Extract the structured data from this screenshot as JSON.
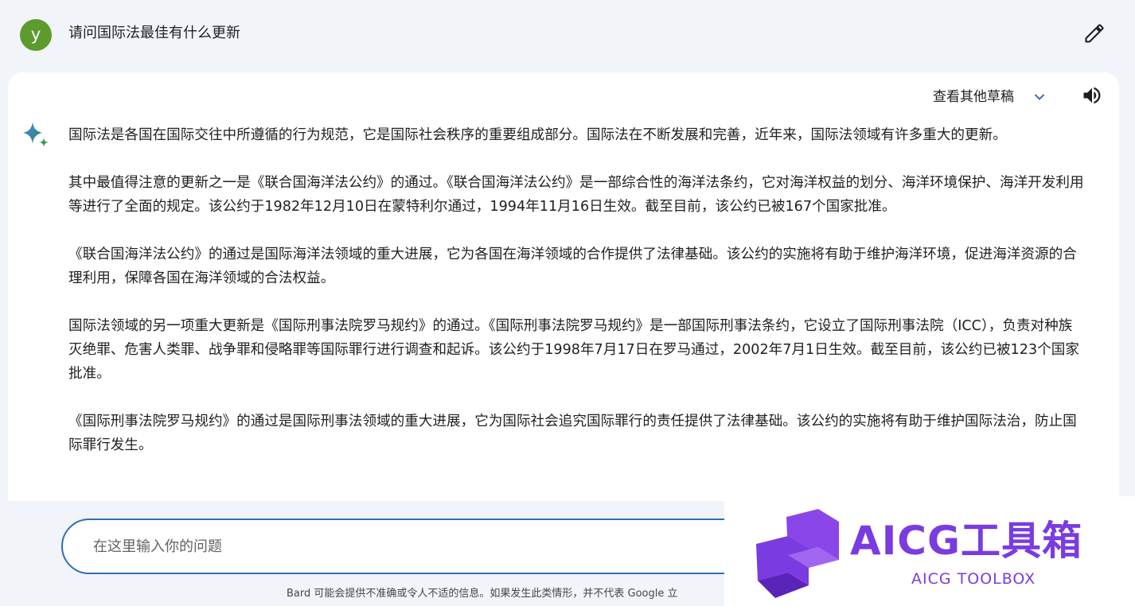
{
  "user": {
    "avatar_letter": "y",
    "query": "请问国际法最佳有什么更新"
  },
  "response": {
    "drafts_label": "查看其他草稿",
    "paragraphs": [
      "国际法是各国在国际交往中所遵循的行为规范，它是国际社会秩序的重要组成部分。国际法在不断发展和完善，近年来，国际法领域有许多重大的更新。",
      "其中最值得注意的更新之一是《联合国海洋法公约》的通过。《联合国海洋法公约》是一部综合性的海洋法条约，它对海洋权益的划分、海洋环境保护、海洋开发利用等进行了全面的规定。该公约于1982年12月10日在蒙特利尔通过，1994年11月16日生效。截至目前，该公约已被167个国家批准。",
      "《联合国海洋法公约》的通过是国际海洋法领域的重大进展，它为各国在海洋领域的合作提供了法律基础。该公约的实施将有助于维护海洋环境，促进海洋资源的合理利用，保障各国在海洋领域的合法权益。",
      "国际法领域的另一项重大更新是《国际刑事法院罗马规约》的通过。《国际刑事法院罗马规约》是一部国际刑事法条约，它设立了国际刑事法院（ICC），负责对种族灭绝罪、危害人类罪、战争罪和侵略罪等国际罪行进行调查和起诉。该公约于1998年7月17日在罗马通过，2002年7月1日生效。截至目前，该公约已被123个国家批准。",
      "《国际刑事法院罗马规约》的通过是国际刑事法领域的重大进展，它为国际社会追究国际罪行的责任提供了法律基础。该公约的实施将有助于维护国际法治，防止国际罪行发生。"
    ]
  },
  "input": {
    "placeholder": "在这里输入你的问题"
  },
  "footer": {
    "disclaimer": "Bard 可能会提供不准确或令人不适的信息。如果发生此类情形，并不代表 Google 立"
  },
  "watermark": {
    "title": "AICG工具箱",
    "subtitle": "AICG TOOLBOX"
  },
  "icons": {
    "edit": "pencil-icon",
    "drafts_toggle": "chevron-down-icon",
    "speaker": "speaker-icon",
    "bard": "sparkle-icon"
  },
  "colors": {
    "avatar": "#5d9b2d",
    "input_border": "#2f6fb0",
    "watermark": "#7a3be0",
    "sparkle_blue": "#4a90e2"
  }
}
